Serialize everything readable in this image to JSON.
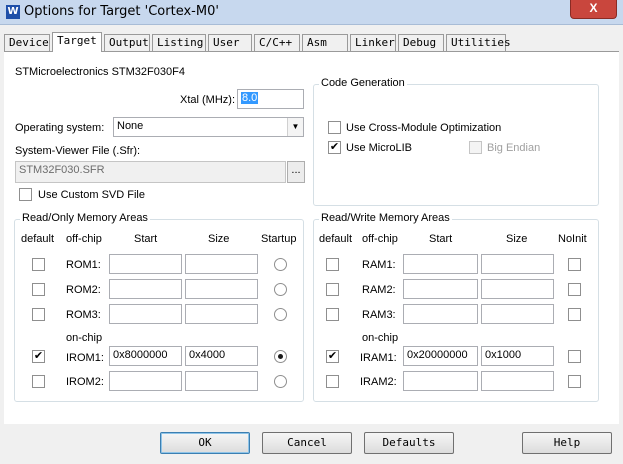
{
  "window": {
    "icon_glyph": "W",
    "title": "Options for Target 'Cortex-M0'",
    "close_glyph": "X"
  },
  "tabs": [
    {
      "label": "Device",
      "active": false
    },
    {
      "label": "Target",
      "active": true
    },
    {
      "label": "Output",
      "active": false
    },
    {
      "label": "Listing",
      "active": false
    },
    {
      "label": "User",
      "active": false
    },
    {
      "label": "C/C++",
      "active": false
    },
    {
      "label": "Asm",
      "active": false
    },
    {
      "label": "Linker",
      "active": false
    },
    {
      "label": "Debug",
      "active": false
    },
    {
      "label": "Utilities",
      "active": false
    }
  ],
  "device_name": "STMicroelectronics STM32F030F4",
  "xtal": {
    "label": "Xtal (MHz):",
    "value": "8.0"
  },
  "os": {
    "label": "Operating system:",
    "selected": "None",
    "arrow_icon": "chevron-down-icon"
  },
  "svf": {
    "label": "System-Viewer File (.Sfr):",
    "value": "STM32F030.SFR",
    "browse_label": "..."
  },
  "custom_svd": {
    "label": "Use Custom SVD File",
    "checked": false
  },
  "code_gen": {
    "title": "Code Generation",
    "cross_module": {
      "label": "Use Cross-Module Optimization",
      "checked": false
    },
    "microlib": {
      "label": "Use MicroLIB",
      "checked": true
    },
    "big_endian": {
      "label": "Big Endian",
      "checked": false,
      "disabled": true
    }
  },
  "ro_memory": {
    "title": "Read/Only Memory Areas",
    "headers": {
      "default": "default",
      "offchip": "off-chip",
      "start": "Start",
      "size": "Size",
      "startup": "Startup"
    },
    "onchip_label": "on-chip",
    "rows": [
      {
        "name": "ROM1:",
        "default": false,
        "start": "",
        "size": "",
        "startup": false
      },
      {
        "name": "ROM2:",
        "default": false,
        "start": "",
        "size": "",
        "startup": false
      },
      {
        "name": "ROM3:",
        "default": false,
        "start": "",
        "size": "",
        "startup": false
      },
      {
        "name": "IROM1:",
        "default": true,
        "start": "0x8000000",
        "size": "0x4000",
        "startup": true
      },
      {
        "name": "IROM2:",
        "default": false,
        "start": "",
        "size": "",
        "startup": false
      }
    ]
  },
  "rw_memory": {
    "title": "Read/Write Memory Areas",
    "headers": {
      "default": "default",
      "offchip": "off-chip",
      "start": "Start",
      "size": "Size",
      "noinit": "NoInit"
    },
    "onchip_label": "on-chip",
    "rows": [
      {
        "name": "RAM1:",
        "default": false,
        "start": "",
        "size": "",
        "noinit": false
      },
      {
        "name": "RAM2:",
        "default": false,
        "start": "",
        "size": "",
        "noinit": false
      },
      {
        "name": "RAM3:",
        "default": false,
        "start": "",
        "size": "",
        "noinit": false
      },
      {
        "name": "IRAM1:",
        "default": true,
        "start": "0x20000000",
        "size": "0x1000",
        "noinit": false
      },
      {
        "name": "IRAM2:",
        "default": false,
        "start": "",
        "size": "",
        "noinit": false
      }
    ]
  },
  "buttons": {
    "ok": "OK",
    "cancel": "Cancel",
    "defaults": "Defaults",
    "help": "Help"
  },
  "check_glyph": "✔"
}
